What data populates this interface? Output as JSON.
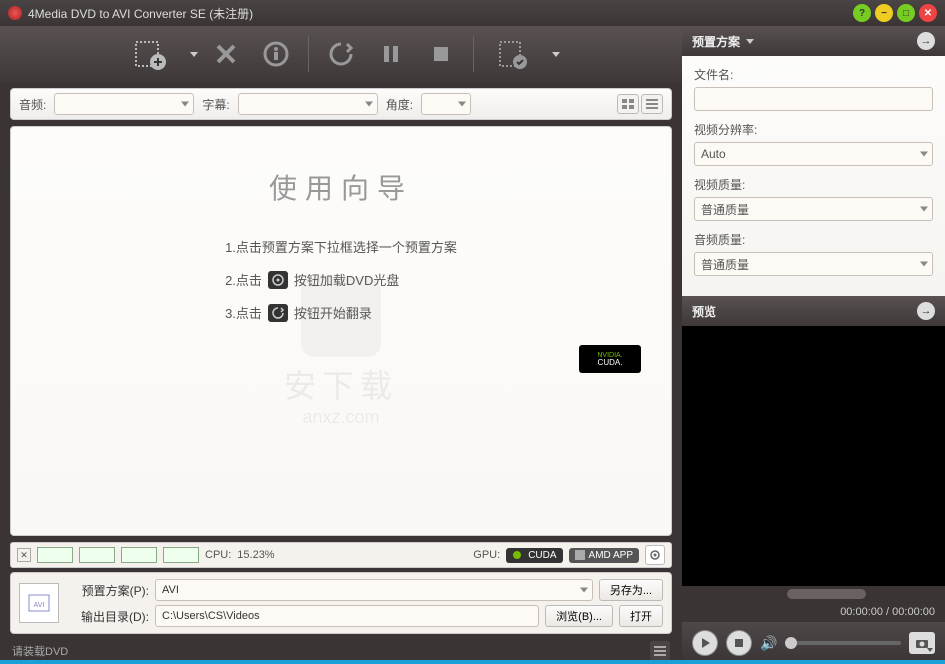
{
  "titlebar": {
    "title": "4Media DVD to AVI Converter SE (未注册)"
  },
  "filters": {
    "audio_label": "音频:",
    "subtitle_label": "字幕:",
    "angle_label": "角度:"
  },
  "wizard": {
    "title": "使用向导",
    "step1": "1.点击预置方案下拉框选择一个预置方案",
    "step2_a": "2.点击",
    "step2_b": "按钮加载DVD光盘",
    "step3_a": "3.点击",
    "step3_b": "按钮开始翻录"
  },
  "cuda": {
    "line1": "NVIDIA.",
    "line2": "CUDA."
  },
  "meters": {
    "cpu_label": "CPU:",
    "cpu_value": "15.23%",
    "gpu_label": "GPU:",
    "cuda": "CUDA",
    "amd": "AMD APP"
  },
  "output": {
    "profile_label": "预置方案(P):",
    "profile_value": "AVI",
    "saveas_btn": "另存为...",
    "dest_label": "输出目录(D):",
    "dest_value": "C:\\Users\\CS\\Videos",
    "browse_btn": "浏览(B)...",
    "open_btn": "打开"
  },
  "status": {
    "text": "请装载DVD"
  },
  "preset": {
    "header": "预置方案",
    "filename_label": "文件名:",
    "filename_value": "",
    "resolution_label": "视频分辨率:",
    "resolution_value": "Auto",
    "vquality_label": "视频质量:",
    "vquality_value": "普通质量",
    "aquality_label": "音频质量:",
    "aquality_value": "普通质量"
  },
  "preview": {
    "header": "预览",
    "time": "00:00:00 / 00:00:00"
  },
  "watermark": {
    "txt1": "安下载",
    "txt2": "anxz.com"
  }
}
